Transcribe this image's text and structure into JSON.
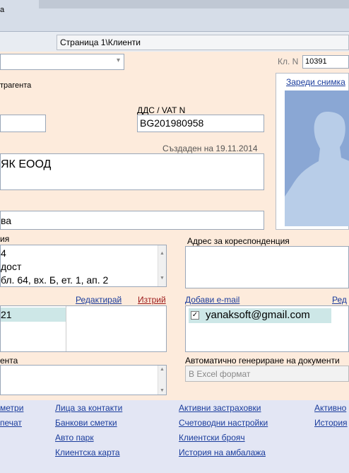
{
  "window": {
    "title_fragment": "а"
  },
  "breadcrumb": "Страница 1\\Клиенти",
  "client_number": {
    "label": "Кл. N",
    "value": "10391"
  },
  "contractor_type_label": "трагента",
  "photo": {
    "load_link": "Зареди снимка"
  },
  "vat": {
    "label": "ДДС / VAT N",
    "value": "BG201980958"
  },
  "created": "Създаден на 19.11.2014",
  "name_value": "ЯК ЕООД",
  "field_partial_value": "ва",
  "address": {
    "label": "ия",
    "lines": [
      "4",
      "дост",
      " бл. 64, вх. Б, ет. 1, ап. 2"
    ]
  },
  "correspondence": {
    "label": "Адрес за кореспонденция",
    "value": ""
  },
  "phones": {
    "edit_link": "Редактирай",
    "delete_link": "Изтрий",
    "items": [
      "21"
    ]
  },
  "emails": {
    "add_link": "Добави e-mail",
    "edit_link_partial": "Ред",
    "items": [
      "yanaksoft@gmail.com"
    ]
  },
  "notes": {
    "label": "ента",
    "value": ""
  },
  "auto_docs": {
    "label": "Автоматично генериране на документи",
    "value": "В Excel формат"
  },
  "bottom_links": {
    "col1": [
      "метри",
      "печат"
    ],
    "col2": [
      "Лица за контакти",
      "Банкови сметки",
      "Авто парк",
      "Клиентска карта"
    ],
    "col3": [
      "Активни застраховки",
      "Счетоводни настройки",
      "Клиентски брояч",
      "История на амбалажа"
    ],
    "col4": [
      "Активно",
      "История"
    ]
  },
  "colors": {
    "form_bg": "#fdebdc",
    "link": "#1a3c9c",
    "bottom_bg": "#e3e6f4"
  }
}
